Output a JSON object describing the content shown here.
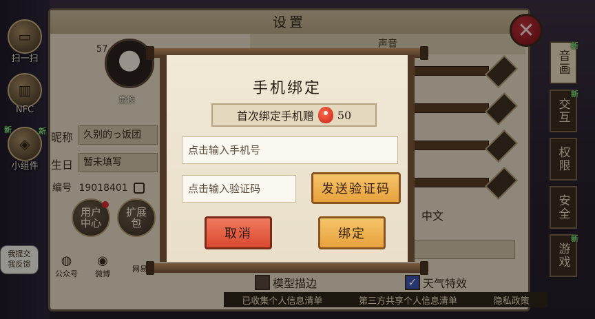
{
  "settings": {
    "title": "设置",
    "close_icon": "close-icon",
    "sound_header": "声音",
    "language_value": "中文",
    "model_outline_label": "模型描边",
    "weather_effect_label": "天气特效",
    "model_outline_checked": false,
    "weather_effect_checked": true
  },
  "side_tools": [
    {
      "label": "扫一扫",
      "icon": "scan-icon"
    },
    {
      "label": "NFC",
      "icon": "nfc-icon"
    },
    {
      "label": "小组件",
      "icon": "widget-icon",
      "new": "新"
    }
  ],
  "profile": {
    "level": "57",
    "change_label": "更换",
    "nickname_label": "昵称",
    "nickname_value": "久别的っ饭团",
    "birthday_label": "生日",
    "birthday_value": "暂未填写",
    "id_label": "编号",
    "id_value": "19018401",
    "user_center_label": "用户中心",
    "expand_label": "扩展包",
    "share_wechat": "公众号",
    "share_weibo": "微博",
    "share_netease": "网易",
    "new_tag": "新"
  },
  "tabs": [
    {
      "label": "音画",
      "new": "新",
      "active": true
    },
    {
      "label": "交互",
      "new": "新",
      "active": false
    },
    {
      "label": "权限",
      "new": "",
      "active": false
    },
    {
      "label": "安全",
      "new": "",
      "active": false
    },
    {
      "label": "游戏",
      "new": "新",
      "active": false
    }
  ],
  "feedback": {
    "text_1": "我提交",
    "text_2": "我反馈"
  },
  "privacy_links": {
    "collected": "已收集个人信息清单",
    "third_party": "第三方共享个人信息清单",
    "policy": "隐私政策"
  },
  "dialog": {
    "title": "手机绑定",
    "bonus_text": "首次绑定手机赠",
    "bonus_icon": "koi-icon",
    "bonus_amount": "50",
    "phone_placeholder": "点击输入手机号",
    "code_placeholder": "点击输入验证码",
    "send_code_label": "发送验证码",
    "cancel_label": "取消",
    "bind_label": "绑定"
  },
  "colors": {
    "cancel_button": "#d9492f",
    "primary_button": "#e7a23c",
    "scroll_wood": "#4e3624",
    "parchment": "#f1e8d6"
  }
}
